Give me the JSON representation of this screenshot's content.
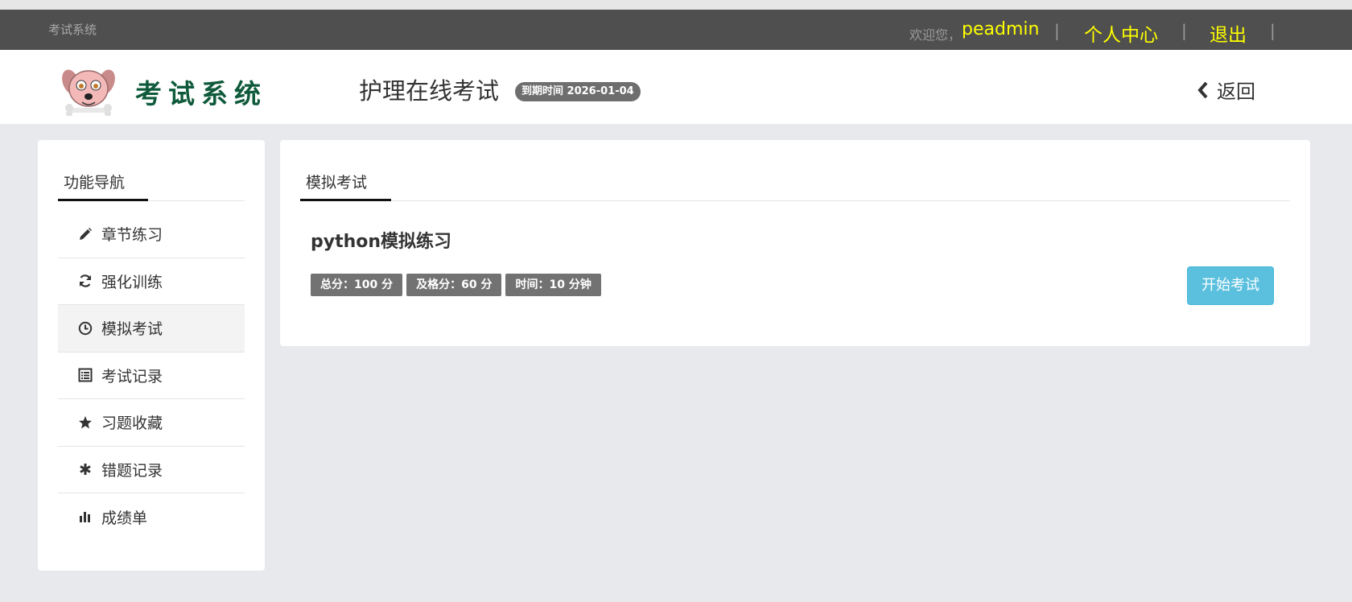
{
  "topbar": {
    "system_name": "考试系统",
    "welcome": "欢迎您，",
    "username": "peadmin",
    "separator": "|",
    "profile_link": "个人中心",
    "logout_link": "退出",
    "link_color": "#ffff00"
  },
  "header": {
    "logo_text": "考试系统",
    "exam_title": "护理在线考试",
    "expire_badge": "到期时间 2026-01-04",
    "back_label": "返回"
  },
  "sidebar": {
    "title": "功能导航",
    "items": [
      {
        "label": "章节练习",
        "icon": "pencil-icon"
      },
      {
        "label": "强化训练",
        "icon": "refresh-icon"
      },
      {
        "label": "模拟考试",
        "icon": "clock-icon",
        "active": true
      },
      {
        "label": "考试记录",
        "icon": "list-icon"
      },
      {
        "label": "习题收藏",
        "icon": "star-icon"
      },
      {
        "label": "错题记录",
        "icon": "asterisk-icon"
      },
      {
        "label": "成绩单",
        "icon": "bar-chart-icon"
      }
    ]
  },
  "main": {
    "tab_label": "模拟考试",
    "exam": {
      "name": "python模拟练习",
      "total_score": "总分：100 分",
      "pass_score": "及格分：60 分",
      "time": "时间：10 分钟",
      "start_button": "开始考试",
      "button_color": "#5bc0de"
    }
  }
}
